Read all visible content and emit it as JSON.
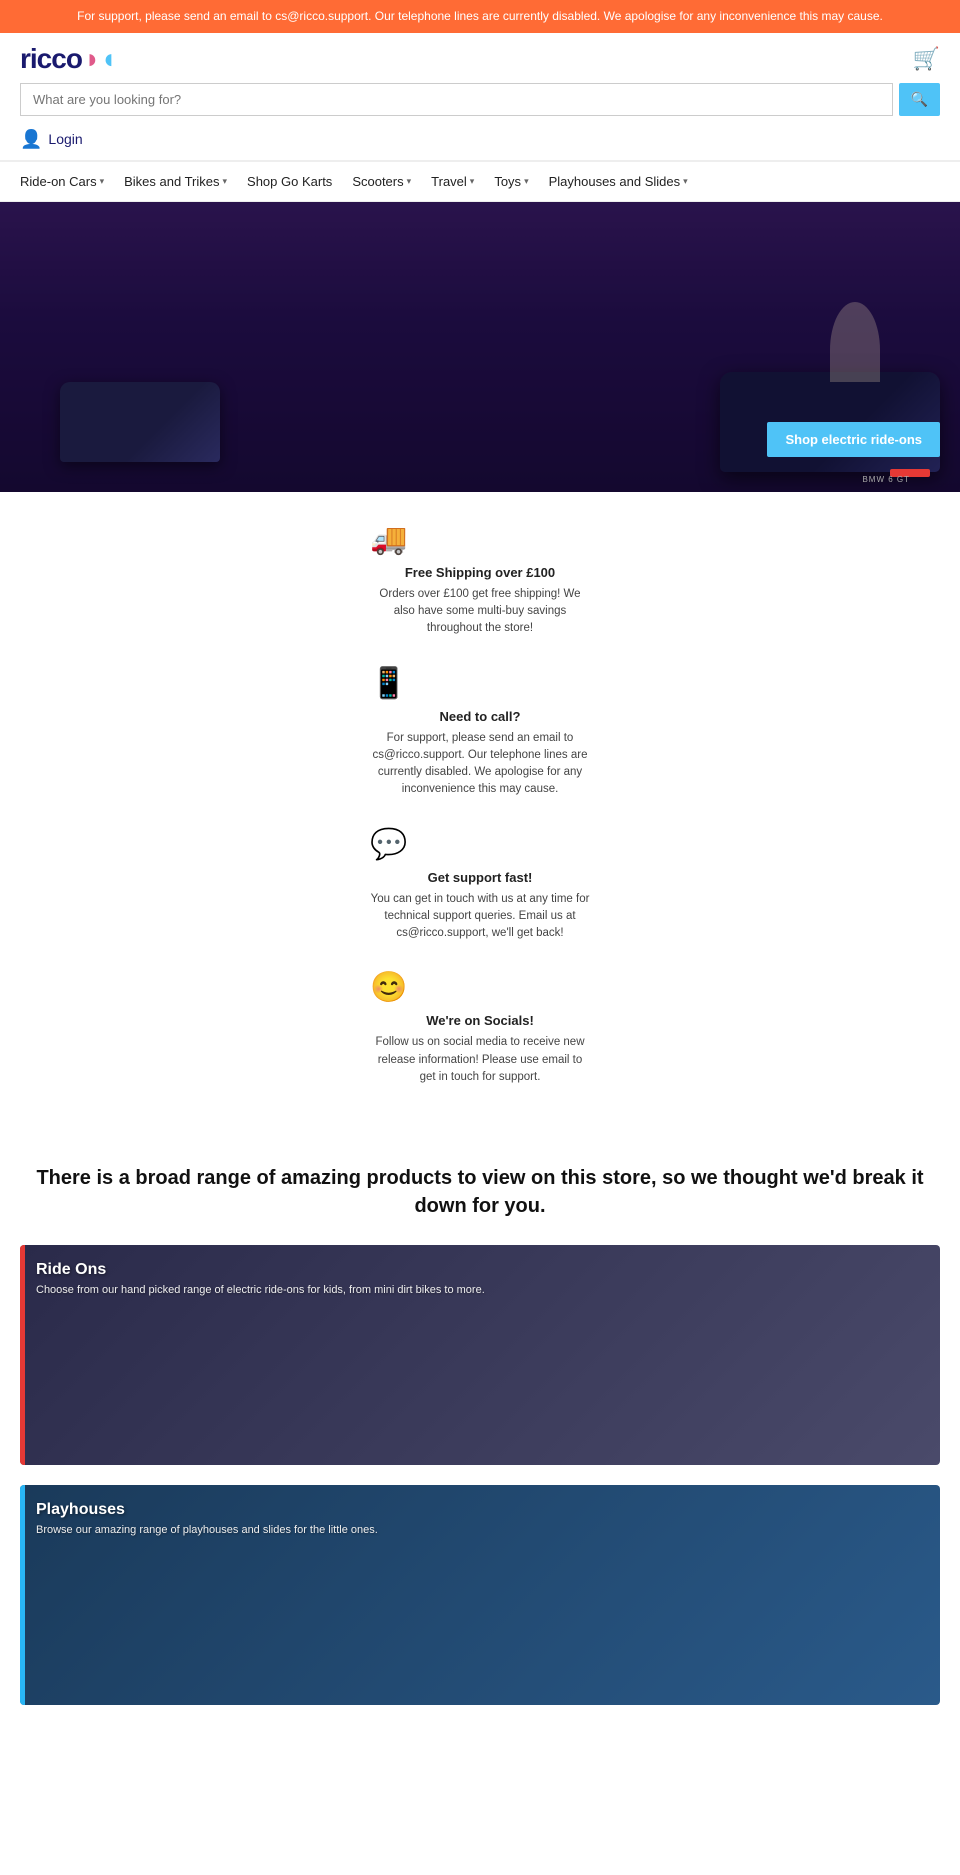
{
  "banner": {
    "text": "For support, please send an email to cs@ricco.support. Our telephone lines are currently disabled. We apologise for any inconvenience this may cause."
  },
  "header": {
    "logo_text": "ricco",
    "search_placeholder": "What are you looking for?",
    "search_button_label": "🔍",
    "login_label": "Login"
  },
  "nav": {
    "items": [
      {
        "label": "Ride-on Cars",
        "has_dropdown": true
      },
      {
        "label": "Bikes and Trikes",
        "has_dropdown": true
      },
      {
        "label": "Shop Go Karts",
        "has_dropdown": false
      },
      {
        "label": "Scooters",
        "has_dropdown": true
      },
      {
        "label": "Travel",
        "has_dropdown": true
      },
      {
        "label": "Toys",
        "has_dropdown": true
      },
      {
        "label": "Playhouses and Slides",
        "has_dropdown": true
      }
    ]
  },
  "hero": {
    "cta_label": "Shop electric ride-ons"
  },
  "info_blocks": [
    {
      "icon": "🚚",
      "title": "Free Shipping over £100",
      "text": "Orders over £100 get free shipping! We also have some multi-buy savings throughout the store!"
    },
    {
      "icon": "📱",
      "title": "Need to call?",
      "text": "For support, please send an email to cs@ricco.support. Our telephone lines are currently disabled. We apologise for any inconvenience this may cause."
    },
    {
      "icon": "💬",
      "title": "Get support fast!",
      "text": "You can get in touch with us at any time for technical support queries. Email us at cs@ricco.support, we'll get back!"
    },
    {
      "icon": "😊",
      "title": "We're on Socials!",
      "text": "Follow us on social media to receive new release information! Please use email to get in touch for support."
    }
  ],
  "category_section": {
    "heading": "There is a broad range of amazing products to view on this store, so we thought we'd break it down for you.",
    "categories": [
      {
        "id": "ride-ons",
        "title": "Ride Ons",
        "description": "Choose from our hand picked range of electric ride-ons for kids, from mini dirt bikes to more.",
        "accent_color": "#e53935",
        "card_class": "ride-on-card"
      },
      {
        "id": "playhouses",
        "title": "Playhouses",
        "description": "Browse our amazing range of playhouses and slides for the little ones.",
        "accent_color": "#29b6f6",
        "card_class": "playhouse-card"
      }
    ]
  }
}
